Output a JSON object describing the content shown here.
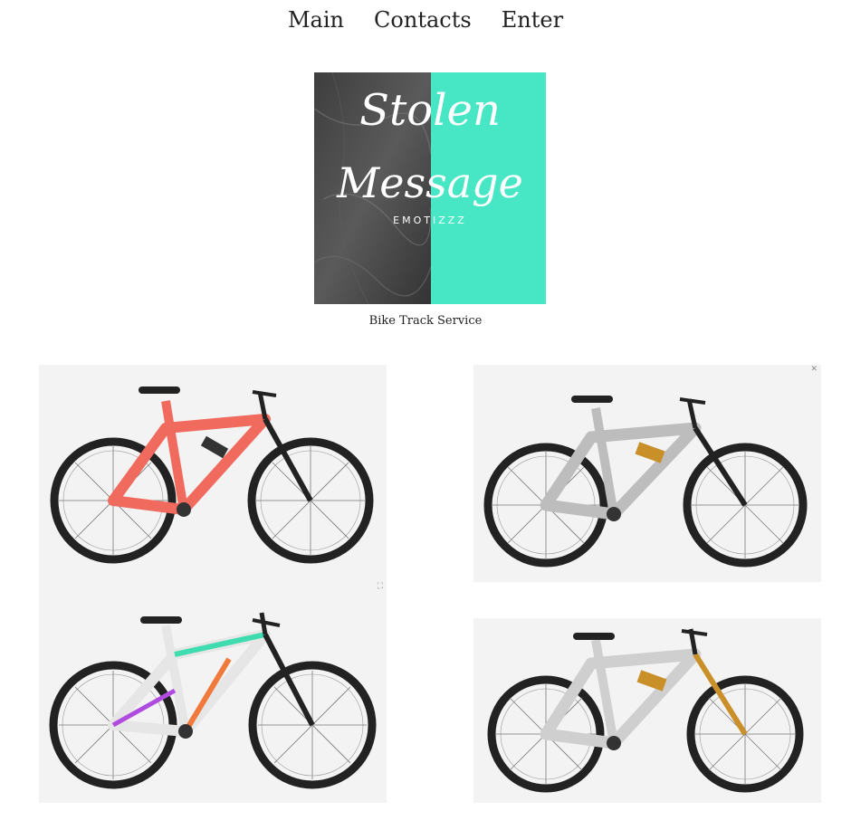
{
  "nav": {
    "items": [
      "Main",
      "Contacts",
      "Enter"
    ]
  },
  "logo": {
    "line1": "Stolen",
    "line2": "Message",
    "tagline": "EMOTIZZZ"
  },
  "caption": "Bike Track Service",
  "bikes": [
    {
      "frame_color": "#f06a5e",
      "accent": "#d84e44"
    },
    {
      "frame_color": "#bdbdbd",
      "accent": "#9a9a9a"
    },
    {
      "frame_color": "#f4f4f4",
      "accent": "#3fdcb0"
    },
    {
      "frame_color": "#cfcfcf",
      "accent": "#a8a8a8"
    }
  ],
  "colors": {
    "teal": "#47e6c4",
    "marble": "#4a4a4a"
  }
}
